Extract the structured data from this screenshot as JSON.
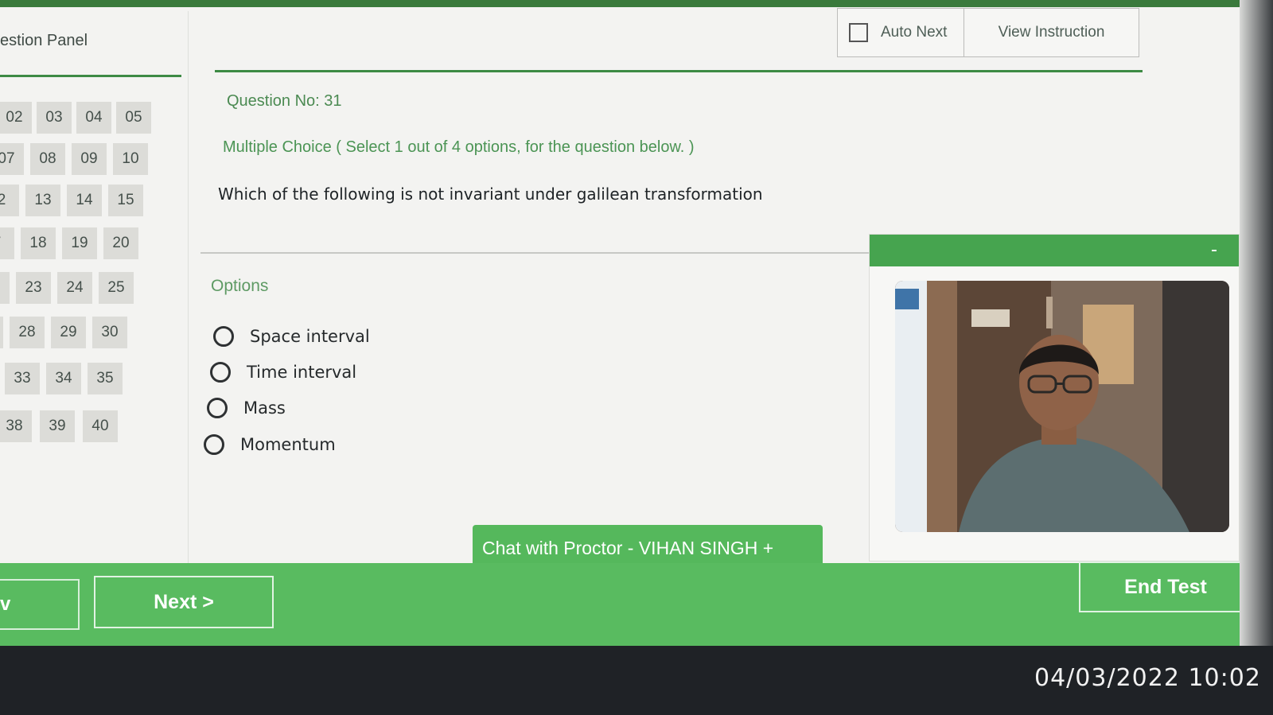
{
  "panel": {
    "title": "estion Panel",
    "question_numbers": [
      "02",
      "03",
      "04",
      "05",
      "07",
      "08",
      "09",
      "10",
      "2",
      "13",
      "14",
      "15",
      "7",
      "18",
      "19",
      "20",
      "",
      "23",
      "24",
      "25",
      "",
      "28",
      "29",
      "30",
      "",
      "33",
      "34",
      "35",
      "38",
      "39",
      "40"
    ]
  },
  "header": {
    "auto_next_label": "Auto Next",
    "view_instruction_label": "View Instruction"
  },
  "question": {
    "number_label": "Question No: 31",
    "type_label": "Multiple Choice ( Select 1 out of 4 options, for the question below. )",
    "text": "Which of the following is not invariant under galilean transformation",
    "options_label": "Options",
    "options": [
      "Space interval",
      "Time interval",
      "Mass",
      "Momentum"
    ]
  },
  "proctor": {
    "video_header_icon": "minimize-icon",
    "chat_label": "Chat with Proctor - VIHAN SINGH  +"
  },
  "footer": {
    "prev_label": "v",
    "next_label": "Next >",
    "end_label": "End Test"
  },
  "photo_timestamp": "04/03/2022 10:02",
  "colors": {
    "accent_green": "#46a44f",
    "footer_green": "#59bb60",
    "rule_green": "#3d8a44"
  }
}
